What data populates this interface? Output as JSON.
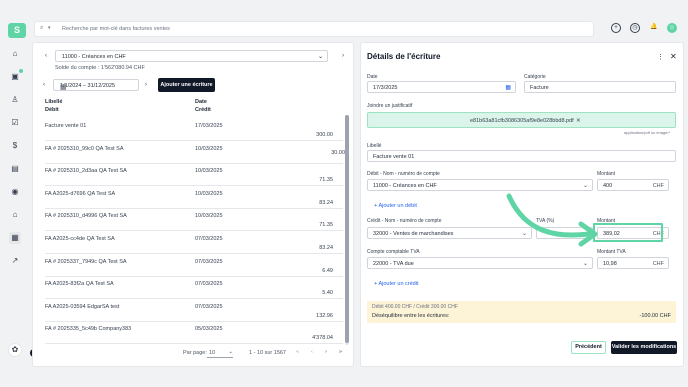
{
  "header": {
    "logo": "S",
    "search_placeholder": "Recherche par mot-clé dans factures ventes"
  },
  "ledger": {
    "account": "11000 - Créances en CHF",
    "solde": "Solde du compte : 1'562'080.94 CHF",
    "date_range": "1/1/2024 – 31/12/2025",
    "add_button": "Ajouter une écriture",
    "col_libelle": "Libellé",
    "col_debit": "Débit",
    "col_date": "Date",
    "col_credit": "Crédit",
    "rows": [
      {
        "label": "Facture vente 01",
        "date": "17/03/2025",
        "debit": "300.00",
        "credit": ""
      },
      {
        "label": "FA # 2025310_99c0 QA Test SA",
        "date": "10/03/2025",
        "debit": "",
        "credit": "30.00"
      },
      {
        "label": "FA # 2025310_2d3aa QA Test SA",
        "date": "10/03/2025",
        "debit": "71.35",
        "credit": ""
      },
      {
        "label": "FA A2025-d7696 QA Test SA",
        "date": "10/03/2025",
        "debit": "83.24",
        "credit": ""
      },
      {
        "label": "FA # 2025310_d4996 QA Test SA",
        "date": "10/03/2025",
        "debit": "71.35",
        "credit": ""
      },
      {
        "label": "FA A2025-cc4de QA Test SA",
        "date": "07/03/2025",
        "debit": "83.24",
        "credit": ""
      },
      {
        "label": "FA # 2025337_7949c QA Test SA",
        "date": "07/03/2025",
        "debit": "6.49",
        "credit": ""
      },
      {
        "label": "FA A2025-83f2a QA Test SA",
        "date": "07/03/2025",
        "debit": "5.40",
        "credit": ""
      },
      {
        "label": "FA A2025-03594 EdgarSA test",
        "date": "07/03/2025",
        "debit": "132.96",
        "credit": ""
      },
      {
        "label": "FA # 2025335_5c49b Company383",
        "date": "05/03/2025",
        "debit": "4'378.04",
        "credit": ""
      }
    ],
    "pager": {
      "per_page_label": "Par page:",
      "per_page": "10",
      "range": "1 - 10 sur 1567"
    }
  },
  "details": {
    "title": "Détails de l'écriture",
    "date_label": "Date",
    "date_value": "17/3/2025",
    "category_label": "Catégorie",
    "category_value": "Facture",
    "attach_label": "Joindre un justificatif",
    "attach_file": "e81b63a81cfb3086305af9e8e028bbd8.pdf",
    "attach_hint": "application/pdf ou image/*",
    "libelle_label": "Libellé",
    "libelle_value": "Facture vente 01",
    "debit_label": "Débit - Nom - numéro de compte",
    "debit_account": "11000 - Créances en CHF",
    "montant_label": "Montant",
    "debit_amount": "400",
    "currency": "CHF",
    "add_debit": "Ajouter un débit",
    "credit_label": "Crédit - Nom - numéro de compte",
    "tva_pct_label": "TVA (%)",
    "credit_account": "32000 - Ventes de marchandises",
    "credit_amount": "389,02",
    "tva_account_label": "Compte comptable TVA",
    "tva_amount_label": "Montant TVA",
    "tva_account": "22000 - TVA due",
    "tva_amount": "10,98",
    "add_credit": "Ajouter un crédit",
    "summary": "Débit 400.00 CHF / Crédit 300.00 CHF",
    "imbalance_label": "Déséquilibre entre les écritures:",
    "imbalance_value": "-100.00 CHF",
    "prev_button": "Précédent",
    "save_button": "Valider les modifications"
  },
  "badge_count": "36",
  "colors": {
    "accent": "#5fd4a5",
    "dark": "#111827",
    "warning_bg": "#fdf3d7"
  }
}
